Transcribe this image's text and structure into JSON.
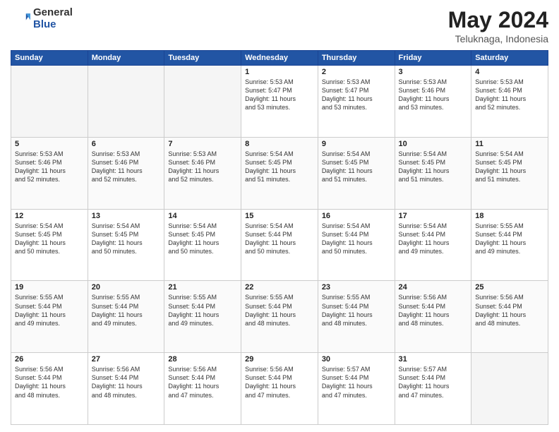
{
  "header": {
    "logo_general": "General",
    "logo_blue": "Blue",
    "title": "May 2024",
    "location": "Teluknaga, Indonesia"
  },
  "days_of_week": [
    "Sunday",
    "Monday",
    "Tuesday",
    "Wednesday",
    "Thursday",
    "Friday",
    "Saturday"
  ],
  "weeks": [
    [
      {
        "day": "",
        "content": ""
      },
      {
        "day": "",
        "content": ""
      },
      {
        "day": "",
        "content": ""
      },
      {
        "day": "1",
        "content": "Sunrise: 5:53 AM\nSunset: 5:47 PM\nDaylight: 11 hours\nand 53 minutes."
      },
      {
        "day": "2",
        "content": "Sunrise: 5:53 AM\nSunset: 5:47 PM\nDaylight: 11 hours\nand 53 minutes."
      },
      {
        "day": "3",
        "content": "Sunrise: 5:53 AM\nSunset: 5:46 PM\nDaylight: 11 hours\nand 53 minutes."
      },
      {
        "day": "4",
        "content": "Sunrise: 5:53 AM\nSunset: 5:46 PM\nDaylight: 11 hours\nand 52 minutes."
      }
    ],
    [
      {
        "day": "5",
        "content": "Sunrise: 5:53 AM\nSunset: 5:46 PM\nDaylight: 11 hours\nand 52 minutes."
      },
      {
        "day": "6",
        "content": "Sunrise: 5:53 AM\nSunset: 5:46 PM\nDaylight: 11 hours\nand 52 minutes."
      },
      {
        "day": "7",
        "content": "Sunrise: 5:53 AM\nSunset: 5:46 PM\nDaylight: 11 hours\nand 52 minutes."
      },
      {
        "day": "8",
        "content": "Sunrise: 5:54 AM\nSunset: 5:45 PM\nDaylight: 11 hours\nand 51 minutes."
      },
      {
        "day": "9",
        "content": "Sunrise: 5:54 AM\nSunset: 5:45 PM\nDaylight: 11 hours\nand 51 minutes."
      },
      {
        "day": "10",
        "content": "Sunrise: 5:54 AM\nSunset: 5:45 PM\nDaylight: 11 hours\nand 51 minutes."
      },
      {
        "day": "11",
        "content": "Sunrise: 5:54 AM\nSunset: 5:45 PM\nDaylight: 11 hours\nand 51 minutes."
      }
    ],
    [
      {
        "day": "12",
        "content": "Sunrise: 5:54 AM\nSunset: 5:45 PM\nDaylight: 11 hours\nand 50 minutes."
      },
      {
        "day": "13",
        "content": "Sunrise: 5:54 AM\nSunset: 5:45 PM\nDaylight: 11 hours\nand 50 minutes."
      },
      {
        "day": "14",
        "content": "Sunrise: 5:54 AM\nSunset: 5:45 PM\nDaylight: 11 hours\nand 50 minutes."
      },
      {
        "day": "15",
        "content": "Sunrise: 5:54 AM\nSunset: 5:44 PM\nDaylight: 11 hours\nand 50 minutes."
      },
      {
        "day": "16",
        "content": "Sunrise: 5:54 AM\nSunset: 5:44 PM\nDaylight: 11 hours\nand 50 minutes."
      },
      {
        "day": "17",
        "content": "Sunrise: 5:54 AM\nSunset: 5:44 PM\nDaylight: 11 hours\nand 49 minutes."
      },
      {
        "day": "18",
        "content": "Sunrise: 5:55 AM\nSunset: 5:44 PM\nDaylight: 11 hours\nand 49 minutes."
      }
    ],
    [
      {
        "day": "19",
        "content": "Sunrise: 5:55 AM\nSunset: 5:44 PM\nDaylight: 11 hours\nand 49 minutes."
      },
      {
        "day": "20",
        "content": "Sunrise: 5:55 AM\nSunset: 5:44 PM\nDaylight: 11 hours\nand 49 minutes."
      },
      {
        "day": "21",
        "content": "Sunrise: 5:55 AM\nSunset: 5:44 PM\nDaylight: 11 hours\nand 49 minutes."
      },
      {
        "day": "22",
        "content": "Sunrise: 5:55 AM\nSunset: 5:44 PM\nDaylight: 11 hours\nand 48 minutes."
      },
      {
        "day": "23",
        "content": "Sunrise: 5:55 AM\nSunset: 5:44 PM\nDaylight: 11 hours\nand 48 minutes."
      },
      {
        "day": "24",
        "content": "Sunrise: 5:56 AM\nSunset: 5:44 PM\nDaylight: 11 hours\nand 48 minutes."
      },
      {
        "day": "25",
        "content": "Sunrise: 5:56 AM\nSunset: 5:44 PM\nDaylight: 11 hours\nand 48 minutes."
      }
    ],
    [
      {
        "day": "26",
        "content": "Sunrise: 5:56 AM\nSunset: 5:44 PM\nDaylight: 11 hours\nand 48 minutes."
      },
      {
        "day": "27",
        "content": "Sunrise: 5:56 AM\nSunset: 5:44 PM\nDaylight: 11 hours\nand 48 minutes."
      },
      {
        "day": "28",
        "content": "Sunrise: 5:56 AM\nSunset: 5:44 PM\nDaylight: 11 hours\nand 47 minutes."
      },
      {
        "day": "29",
        "content": "Sunrise: 5:56 AM\nSunset: 5:44 PM\nDaylight: 11 hours\nand 47 minutes."
      },
      {
        "day": "30",
        "content": "Sunrise: 5:57 AM\nSunset: 5:44 PM\nDaylight: 11 hours\nand 47 minutes."
      },
      {
        "day": "31",
        "content": "Sunrise: 5:57 AM\nSunset: 5:44 PM\nDaylight: 11 hours\nand 47 minutes."
      },
      {
        "day": "",
        "content": ""
      }
    ]
  ]
}
